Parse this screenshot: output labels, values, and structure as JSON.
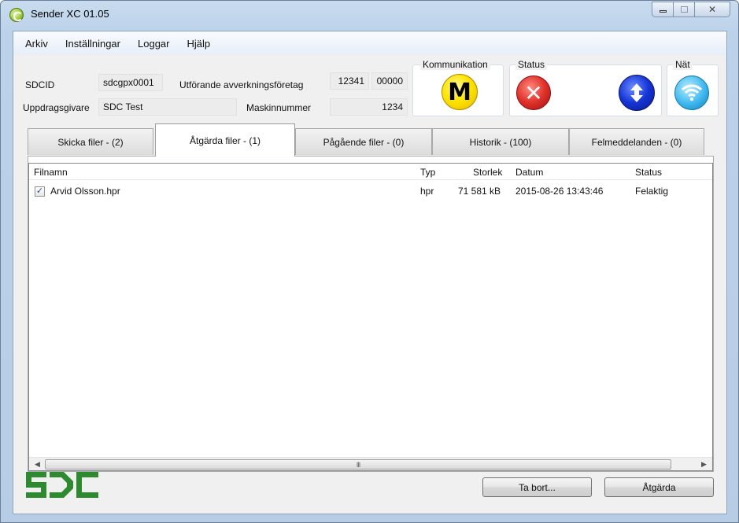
{
  "window": {
    "title": "Sender XC 01.05"
  },
  "menu": [
    "Arkiv",
    "Inställningar",
    "Loggar",
    "Hjälp"
  ],
  "info": {
    "sdcid_label": "SDCID",
    "sdcid_value": "sdcgpx0001",
    "uppdragsgivare_label": "Uppdragsgivare",
    "uppdragsgivare_value": "SDC Test",
    "utforande_label": "Utförande avverkningsföretag",
    "utforande_value1": "12341",
    "utforande_value2": "00000",
    "maskinnummer_label": "Maskinnummer",
    "maskinnummer_value": "1234"
  },
  "groups": {
    "kommunikation": "Kommunikation",
    "status": "Status",
    "nat": "Nät"
  },
  "icons": {
    "kommunikation": "m-icon",
    "status": "error-icon",
    "transfer": "up-down-arrows-icon",
    "nat": "wifi-icon",
    "m_glyph": "M"
  },
  "tabs": [
    {
      "label": "Skicka filer - (2)",
      "active": false
    },
    {
      "label": "Åtgärda filer - (1)",
      "active": true
    },
    {
      "label": "Pågående filer - (0)",
      "active": false
    },
    {
      "label": "Historik - (100)",
      "active": false
    },
    {
      "label": "Felmeddelanden - (0)",
      "active": false
    }
  ],
  "table": {
    "columns": [
      "Filnamn",
      "Typ",
      "Storlek",
      "Datum",
      "Status"
    ],
    "rows": [
      {
        "checked": true,
        "filnamn": "Arvid Olsson.hpr",
        "typ": "hpr",
        "storlek": "71 581 kB",
        "datum": "2015-08-26 13:43:46",
        "status": "Felaktig"
      }
    ]
  },
  "scrollbar": {
    "grip": "III"
  },
  "buttons": {
    "ta_bort": "Ta bort...",
    "atgarda": "Åtgärda"
  },
  "logo": {
    "text": "SDC",
    "color": "#2e8a2e"
  },
  "colors": {
    "accent": "#2e8a2e",
    "error": "#e0322b",
    "info": "#1535d6",
    "warning": "#ffe600"
  }
}
